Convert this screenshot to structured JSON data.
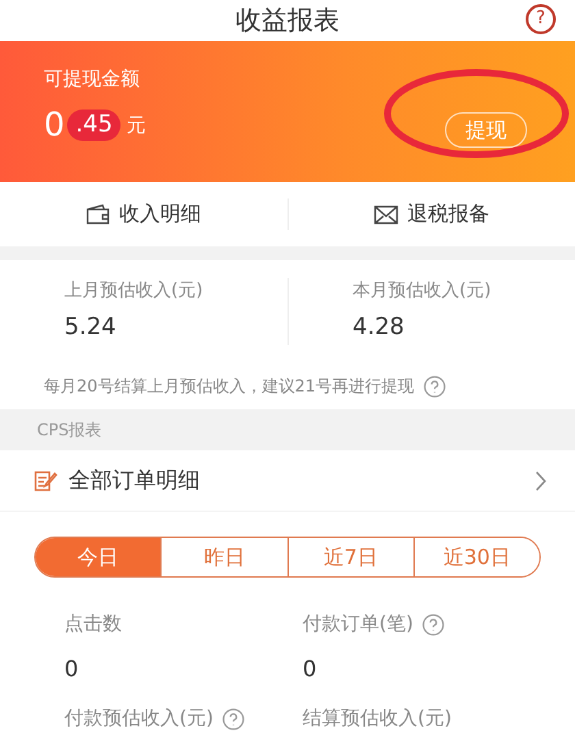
{
  "header": {
    "title": "收益报表",
    "help": "?"
  },
  "balance": {
    "label": "可提现金额",
    "amount_int": "0",
    "amount_dec": ".45",
    "unit": "元",
    "withdraw_button": "提现",
    "annotated": true
  },
  "actions": [
    {
      "kind": "wallet",
      "label": "收入明细"
    },
    {
      "kind": "envelope",
      "label": "退税报备"
    }
  ],
  "estimates": [
    {
      "label": "上月预估收入(元)",
      "value": "5.24"
    },
    {
      "label": "本月预估收入(元)",
      "value": "4.28"
    }
  ],
  "note": "每月20号结算上月预估收入，建议21号再进行提现",
  "section_title": "CPS报表",
  "orders_link": "全部订单明细",
  "tabs": [
    {
      "label": "今日",
      "selected": true
    },
    {
      "label": "昨日",
      "selected": false
    },
    {
      "label": "近7日",
      "selected": false
    },
    {
      "label": "近30日",
      "selected": false
    }
  ],
  "metrics": [
    {
      "label": "点击数",
      "value": "0",
      "help": false
    },
    {
      "label": "付款订单(笔)",
      "value": "0",
      "help": true
    },
    {
      "label": "付款预估收入(元)",
      "help": true
    },
    {
      "label": "结算预估收入(元)",
      "help": false
    }
  ]
}
